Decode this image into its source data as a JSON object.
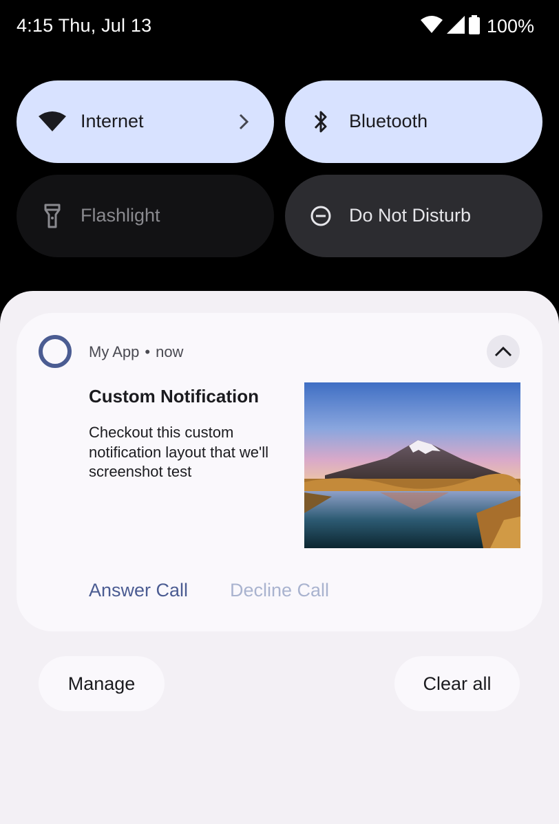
{
  "status_bar": {
    "time_date": "4:15 Thu, Jul 13",
    "battery": "100%",
    "icons": [
      "wifi-icon",
      "cellular-signal-icon",
      "battery-icon"
    ]
  },
  "quick_settings": {
    "tiles": [
      {
        "label": "Internet",
        "icon": "wifi-icon",
        "state": "on"
      },
      {
        "label": "Bluetooth",
        "icon": "bluetooth-icon",
        "state": "on"
      },
      {
        "label": "Flashlight",
        "icon": "flashlight-icon",
        "state": "unavailable"
      },
      {
        "label": "Do Not Disturb",
        "icon": "do-not-disturb-icon",
        "state": "off"
      }
    ]
  },
  "notification": {
    "app_name": "My App",
    "separator": "•",
    "time": "now",
    "title": "Custom Notification",
    "body": "Checkout this custom notification layout that we'll screenshot test",
    "image": "mountain-lake-image",
    "actions": [
      {
        "label": "Answer Call",
        "color": "#4b5c92"
      },
      {
        "label": "Decline Call",
        "color": "#a9b3cf"
      }
    ]
  },
  "footer": {
    "manage_label": "Manage",
    "clear_all_label": "Clear all"
  },
  "colors": {
    "tile_on": "#d8e2ff",
    "tile_off": "#2c2c30",
    "accent": "#4b5c92",
    "shade_bg": "#f3f0f5"
  }
}
